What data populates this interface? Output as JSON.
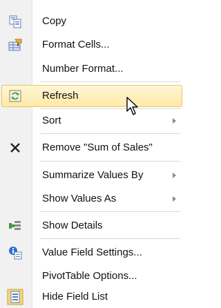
{
  "menu": {
    "items": [
      {
        "label": "Copy",
        "icon": "copy-icon"
      },
      {
        "label": "Format Cells...",
        "icon": "format-cells-icon"
      },
      {
        "label": "Number Format..."
      },
      {
        "label": "Refresh",
        "icon": "refresh-icon",
        "highlighted": true
      },
      {
        "label": "Sort",
        "submenu": true
      },
      {
        "label": "Remove \"Sum of Sales\"",
        "icon": "remove-x-icon"
      },
      {
        "label": "Summarize Values By",
        "submenu": true
      },
      {
        "label": "Show Values As",
        "submenu": true
      },
      {
        "label": "Show Details",
        "icon": "show-details-icon"
      },
      {
        "label": "Value Field Settings...",
        "icon": "value-field-settings-icon"
      },
      {
        "label": "PivotTable Options..."
      },
      {
        "label": "Hide Field List",
        "icon": "hide-field-list-icon"
      }
    ]
  },
  "colors": {
    "highlight_fill": "#ffe9a6",
    "highlight_border": "#e8c56a",
    "gutter": "#f1f1f1",
    "separator": "#d8d8d8"
  }
}
